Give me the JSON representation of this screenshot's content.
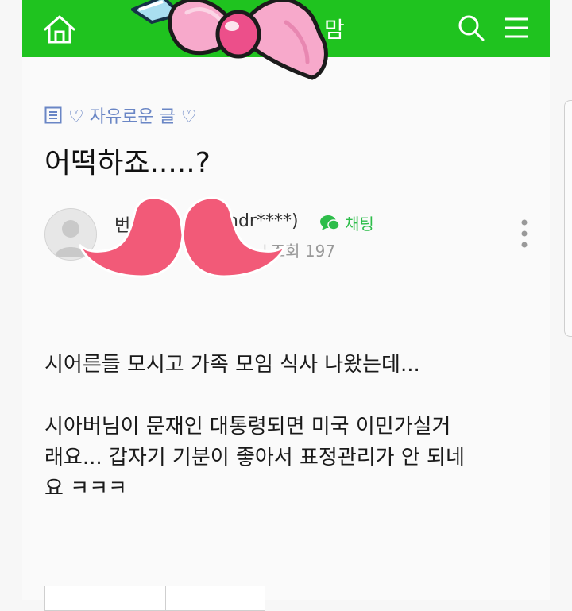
{
  "header": {
    "title_fragment": "맘",
    "home_icon": "home-icon",
    "search_icon": "search-icon",
    "menu_icon": "hamburger-menu-icon",
    "accent_color": "#1fc31f"
  },
  "stickers": {
    "bow": "pink-bow-sticker",
    "mustache": "mustache-sticker"
  },
  "post": {
    "board_name": "♡ 자유로운 글 ♡",
    "title": "어떡하죠.....?",
    "author": {
      "nickname_visible": "번",
      "id_visible": "ndr****)",
      "avatar_icon": "default-avatar-icon"
    },
    "chat_label": "채팅",
    "view_count": "조회 197",
    "paragraphs": [
      "시어른들 모시고 가족 모임 식사 나왔는데...",
      "시아버님이 문재인 대통령되면 미국 이민가실거\n래요... 갑자기 기분이 좋아서 표정관리가 안 되네\n요 ㅋㅋㅋ"
    ]
  }
}
